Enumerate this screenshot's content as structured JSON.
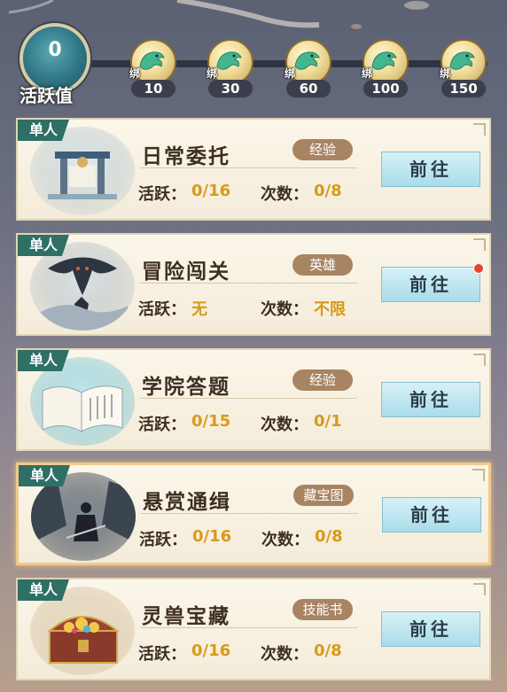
{
  "activity": {
    "value": "0",
    "label": "活跃值",
    "rewards": [
      {
        "bind": "绑",
        "threshold": "10"
      },
      {
        "bind": "绑",
        "threshold": "30"
      },
      {
        "bind": "绑",
        "threshold": "60"
      },
      {
        "bind": "绑",
        "threshold": "100"
      },
      {
        "bind": "绑",
        "threshold": "150"
      }
    ]
  },
  "tasks": [
    {
      "mode": "单人",
      "title": "日常委托",
      "reward_tag": "经验",
      "activity_label": "活跃：",
      "activity_value": "0/16",
      "count_label": "次数：",
      "count_value": "0/8",
      "button": "前往",
      "has_alert": false
    },
    {
      "mode": "单人",
      "title": "冒险闯关",
      "reward_tag": "英雄",
      "activity_label": "活跃：",
      "activity_value": "无",
      "count_label": "次数：",
      "count_value": "不限",
      "button": "前往",
      "has_alert": true
    },
    {
      "mode": "单人",
      "title": "学院答题",
      "reward_tag": "经验",
      "activity_label": "活跃：",
      "activity_value": "0/15",
      "count_label": "次数：",
      "count_value": "0/1",
      "button": "前往",
      "has_alert": false
    },
    {
      "mode": "单人",
      "title": "悬赏通缉",
      "reward_tag": "藏宝图",
      "activity_label": "活跃：",
      "activity_value": "0/16",
      "count_label": "次数：",
      "count_value": "0/8",
      "button": "前往",
      "has_alert": false
    },
    {
      "mode": "单人",
      "title": "灵兽宝藏",
      "reward_tag": "技能书",
      "activity_label": "活跃：",
      "activity_value": "0/16",
      "count_label": "次数：",
      "count_value": "0/8",
      "button": "前往",
      "has_alert": false
    }
  ],
  "colors": {
    "accent_tag": "#2e6f66",
    "value_gold": "#d79a1a",
    "button_blue": "#a9dcea",
    "alert_red": "#e8442a"
  }
}
